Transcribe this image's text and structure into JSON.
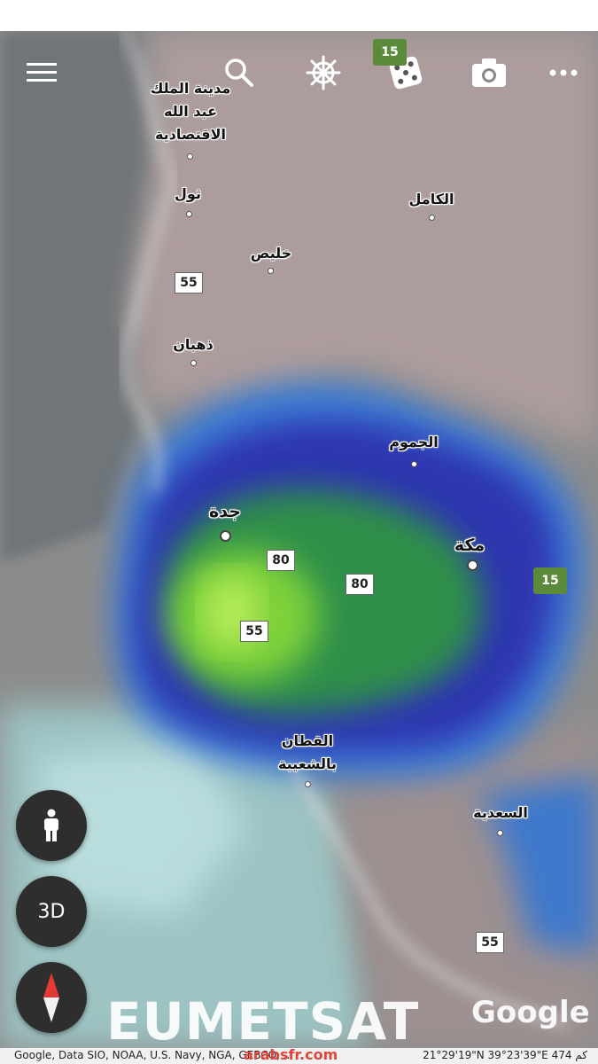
{
  "toolbar": {
    "menu_icon": "hamburger-menu-icon",
    "search_icon": "search-icon",
    "voyager_icon": "ship-wheel-icon",
    "feeling_lucky_icon": "dice-icon",
    "camera_icon": "camera-icon",
    "more_icon": "more-dots-icon"
  },
  "places": [
    {
      "name": "مدينة الملك عبد الله الاقتصادية"
    },
    {
      "name": "ثول"
    },
    {
      "name": "الكامل"
    },
    {
      "name": "خليص"
    },
    {
      "name": "ذهبان"
    },
    {
      "name": "الجموم"
    },
    {
      "name": "جدة"
    },
    {
      "name": "مكة"
    },
    {
      "name": "القطان بالشعيبة"
    },
    {
      "name": "السعدية"
    }
  ],
  "roads": [
    "55",
    "80",
    "80",
    "55",
    "55"
  ],
  "green_shields": [
    "15",
    "15"
  ],
  "fabs": {
    "pegman": "person-icon",
    "three_d": "3D",
    "compass": "compass-icon"
  },
  "watermark": "EUMETSAT",
  "google_logo": "Google",
  "attribution": {
    "left": "Google, Data SIO, NOAA, U.S. Navy, NGA, GEBCO, ...",
    "right": "21°29'19\"N 39°23'39\"E  474 كم",
    "site": "arabsfr.com"
  },
  "colors": {
    "precip_core": "#7ed23a",
    "precip_mid": "#2f9a3c",
    "precip_outer": "#2e3ab8",
    "precip_edge": "#3a7fd8"
  }
}
